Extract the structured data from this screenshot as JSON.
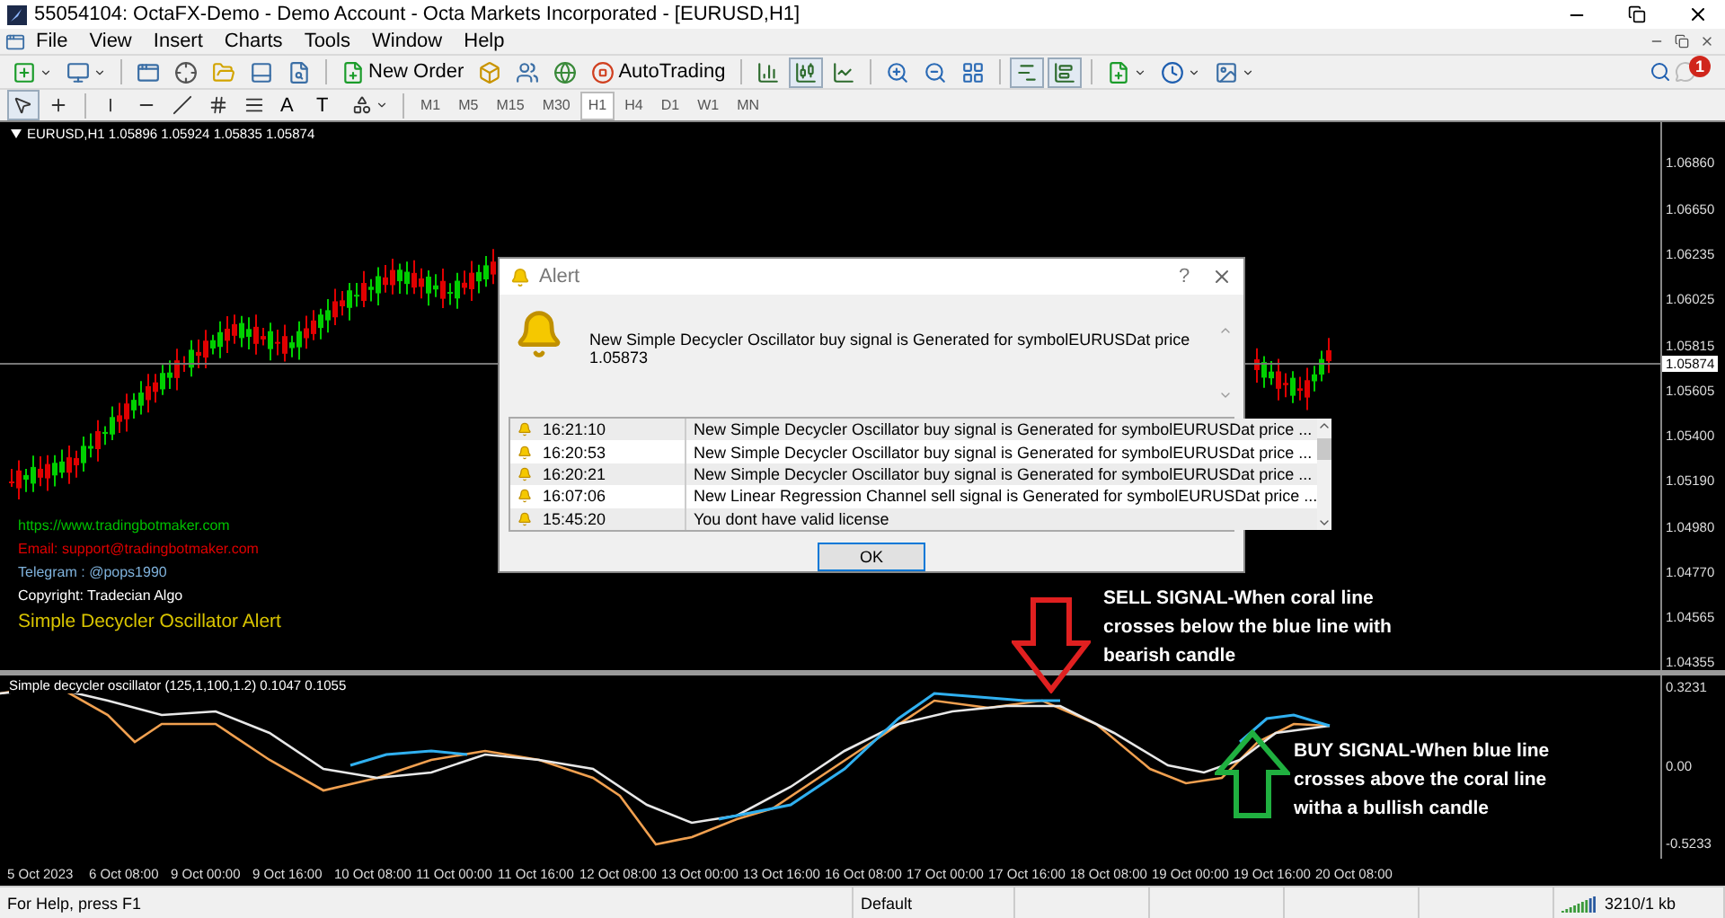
{
  "window": {
    "title": "55054104: OctaFX-Demo - Demo Account - Octa Markets Incorporated - [EURUSD,H1]"
  },
  "menu": [
    "File",
    "View",
    "Insert",
    "Charts",
    "Tools",
    "Window",
    "Help"
  ],
  "toolbar": {
    "items": [
      {
        "kind": "icon",
        "dropdown": true
      },
      {
        "kind": "icon",
        "dropdown": true
      },
      {
        "kind": "separator"
      },
      {
        "kind": "icon"
      },
      {
        "kind": "icon"
      },
      {
        "kind": "icon"
      },
      {
        "kind": "icon"
      },
      {
        "kind": "icon"
      },
      {
        "kind": "separator"
      },
      {
        "kind": "button",
        "label": "New Order"
      },
      {
        "kind": "icon"
      },
      {
        "kind": "icon"
      },
      {
        "kind": "icon"
      },
      {
        "kind": "button",
        "label": "AutoTrading"
      },
      {
        "kind": "separator"
      },
      {
        "kind": "toggle",
        "pressed": false
      },
      {
        "kind": "toggle",
        "pressed": true
      },
      {
        "kind": "toggle",
        "pressed": false
      },
      {
        "kind": "separator"
      },
      {
        "kind": "icon"
      },
      {
        "kind": "icon"
      },
      {
        "kind": "icon"
      },
      {
        "kind": "separator"
      },
      {
        "kind": "toggle",
        "pressed": true
      },
      {
        "kind": "toggle",
        "pressed": true
      },
      {
        "kind": "separator"
      },
      {
        "kind": "icon",
        "dropdown": true
      },
      {
        "kind": "icon",
        "dropdown": true
      },
      {
        "kind": "icon",
        "dropdown": true
      }
    ],
    "notification_count": "1"
  },
  "drawing_toolbar": {
    "items": [
      {
        "kind": "toggle",
        "pressed": true
      },
      {
        "kind": "toggle",
        "pressed": false
      },
      {
        "kind": "separator"
      },
      {
        "kind": "toggle",
        "pressed": false
      },
      {
        "kind": "toggle",
        "pressed": false
      },
      {
        "kind": "toggle",
        "pressed": false
      },
      {
        "kind": "toggle",
        "pressed": false
      },
      {
        "kind": "toggle",
        "pressed": false
      },
      {
        "kind": "text",
        "label": "A"
      },
      {
        "kind": "text",
        "label": "T"
      },
      {
        "kind": "icon",
        "dropdown": true
      }
    ],
    "timeframes": [
      {
        "label": "M1",
        "selected": false
      },
      {
        "label": "M5",
        "selected": false
      },
      {
        "label": "M15",
        "selected": false
      },
      {
        "label": "M30",
        "selected": false
      },
      {
        "label": "H1",
        "selected": true
      },
      {
        "label": "H4",
        "selected": false
      },
      {
        "label": "D1",
        "selected": false
      },
      {
        "label": "W1",
        "selected": false
      },
      {
        "label": "MN",
        "selected": false
      }
    ]
  },
  "chart": {
    "header": "EURUSD,H1  1.05896 1.05924 1.05835 1.05874",
    "price_labels": [
      "1.06860",
      "1.06650",
      "1.06235",
      "1.06025",
      "1.05815",
      "1.05605",
      "1.05400",
      "1.05190",
      "1.04980",
      "1.04770",
      "1.04565",
      "1.04355"
    ],
    "current_price": "1.05874",
    "overlay_texts": [
      {
        "text": "https://www.tradingbotmaker.com",
        "color": "#00c000",
        "kind": "line"
      },
      {
        "text": "Email: support@tradingbotmaker.com",
        "color": "#e00000",
        "kind": "line"
      },
      {
        "text": "Telegram : @pops1990",
        "color": "#7fb2dc",
        "kind": "line"
      },
      {
        "text": "Copyright: Tradecian Algo",
        "color": "#ffffff",
        "kind": "line"
      },
      {
        "text": "Simple Decycler Oscillator Alert",
        "color": "#d8c400",
        "kind": "heading"
      }
    ],
    "oscillator": {
      "label": "Simple decycler oscillator (125,1,100,1.2) 0.1047 0.1055",
      "scale": [
        "0.3231",
        "0.00",
        "-0.5233"
      ]
    },
    "time_labels": [
      "5 Oct 2023",
      "6 Oct 08:00",
      "9 Oct 00:00",
      "9 Oct 16:00",
      "10 Oct 08:00",
      "11 Oct 00:00",
      "11 Oct 16:00",
      "12 Oct 08:00",
      "13 Oct 00:00",
      "13 Oct 16:00",
      "16 Oct 08:00",
      "17 Oct 00:00",
      "17 Oct 16:00",
      "18 Oct 08:00",
      "19 Oct 00:00",
      "19 Oct 16:00",
      "20 Oct 08:00"
    ],
    "annotations": [
      {
        "kind": "sell",
        "text": "SELL SIGNAL-When coral line\ncrosses below the blue line with\nbearish candle"
      },
      {
        "kind": "buy",
        "text": "BUY SIGNAL-When blue line\ncrosses above the coral line\nwitha a bullish candle"
      }
    ]
  },
  "alert": {
    "title": "Alert",
    "help": "?",
    "message": "New Simple Decycler Oscillator buy signal is Generated for symbolEURUSDat price 1.05873",
    "rows": [
      {
        "time": "16:21:10",
        "message": "New Simple Decycler Oscillator buy signal is Generated for symbolEURUSDat price ..."
      },
      {
        "time": "16:20:53",
        "message": "New Simple Decycler Oscillator buy signal is Generated for symbolEURUSDat price ..."
      },
      {
        "time": "16:20:21",
        "message": "New Simple Decycler Oscillator buy signal is Generated for symbolEURUSDat price ..."
      },
      {
        "time": "16:07:06",
        "message": "New Linear Regression Channel sell signal is Generated for symbolEURUSDat price ..."
      },
      {
        "time": "15:45:20",
        "message": "You dont have valid license"
      }
    ],
    "ok": "OK"
  },
  "status_bar": {
    "help": "For Help, press F1",
    "profile": "Default",
    "traffic": "3210/1 kb"
  }
}
